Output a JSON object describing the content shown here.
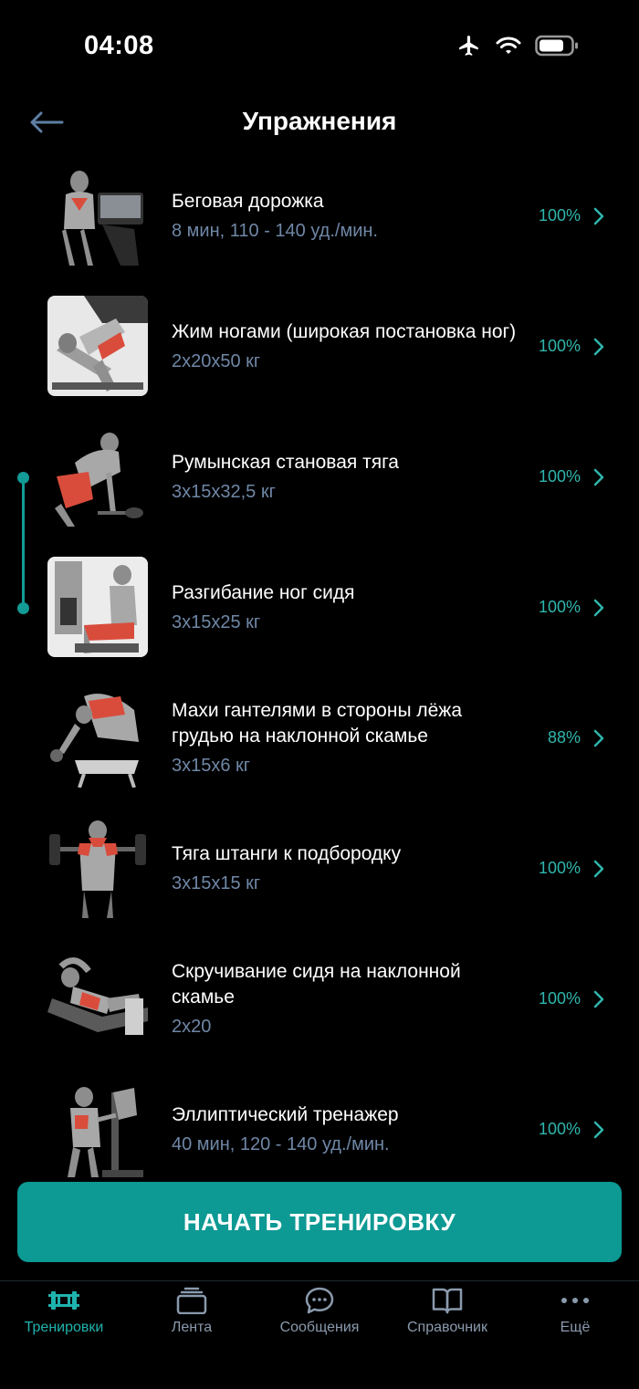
{
  "status_bar": {
    "time": "04:08"
  },
  "header": {
    "title": "Упражнения"
  },
  "exercises": [
    {
      "name": "Беговая дорожка",
      "detail": "8 мин, 110 - 140 уд./мин.",
      "percent": "100%"
    },
    {
      "name": "Жим ногами (широкая постановка ног)",
      "detail": "2x20x50 кг",
      "percent": "100%"
    },
    {
      "name": "Румынская становая тяга",
      "detail": "3x15x32,5 кг",
      "percent": "100%"
    },
    {
      "name": "Разгибание ног сидя",
      "detail": "3x15x25 кг",
      "percent": "100%"
    },
    {
      "name": "Махи гантелями в стороны лёжа грудью на наклонной скамье",
      "detail": "3x15x6 кг",
      "percent": "88%"
    },
    {
      "name": "Тяга штанги к подбородку",
      "detail": "3x15x15 кг",
      "percent": "100%"
    },
    {
      "name": "Скручивание сидя на наклонной скамье",
      "detail": "2x20",
      "percent": "100%"
    },
    {
      "name": "Эллиптический тренажер",
      "detail": "40 мин, 120 - 140 уд./мин.",
      "percent": "100%"
    }
  ],
  "start_button": {
    "label": "НАЧАТЬ ТРЕНИРОВКУ"
  },
  "tab_bar": {
    "tabs": [
      {
        "label": "Тренировки",
        "icon": "dumbbell-icon",
        "active": true
      },
      {
        "label": "Лента",
        "icon": "stack-icon"
      },
      {
        "label": "Сообщения",
        "icon": "chat-bubble-icon"
      },
      {
        "label": "Справочник",
        "icon": "book-icon"
      },
      {
        "label": "Ещё",
        "icon": "more-dots-icon"
      }
    ]
  },
  "colors": {
    "accent": "#0d9994",
    "percent": "#2fb6ad",
    "detail_text": "#6f87a6",
    "tab_inactive": "#8a9aad",
    "background": "#000000"
  }
}
